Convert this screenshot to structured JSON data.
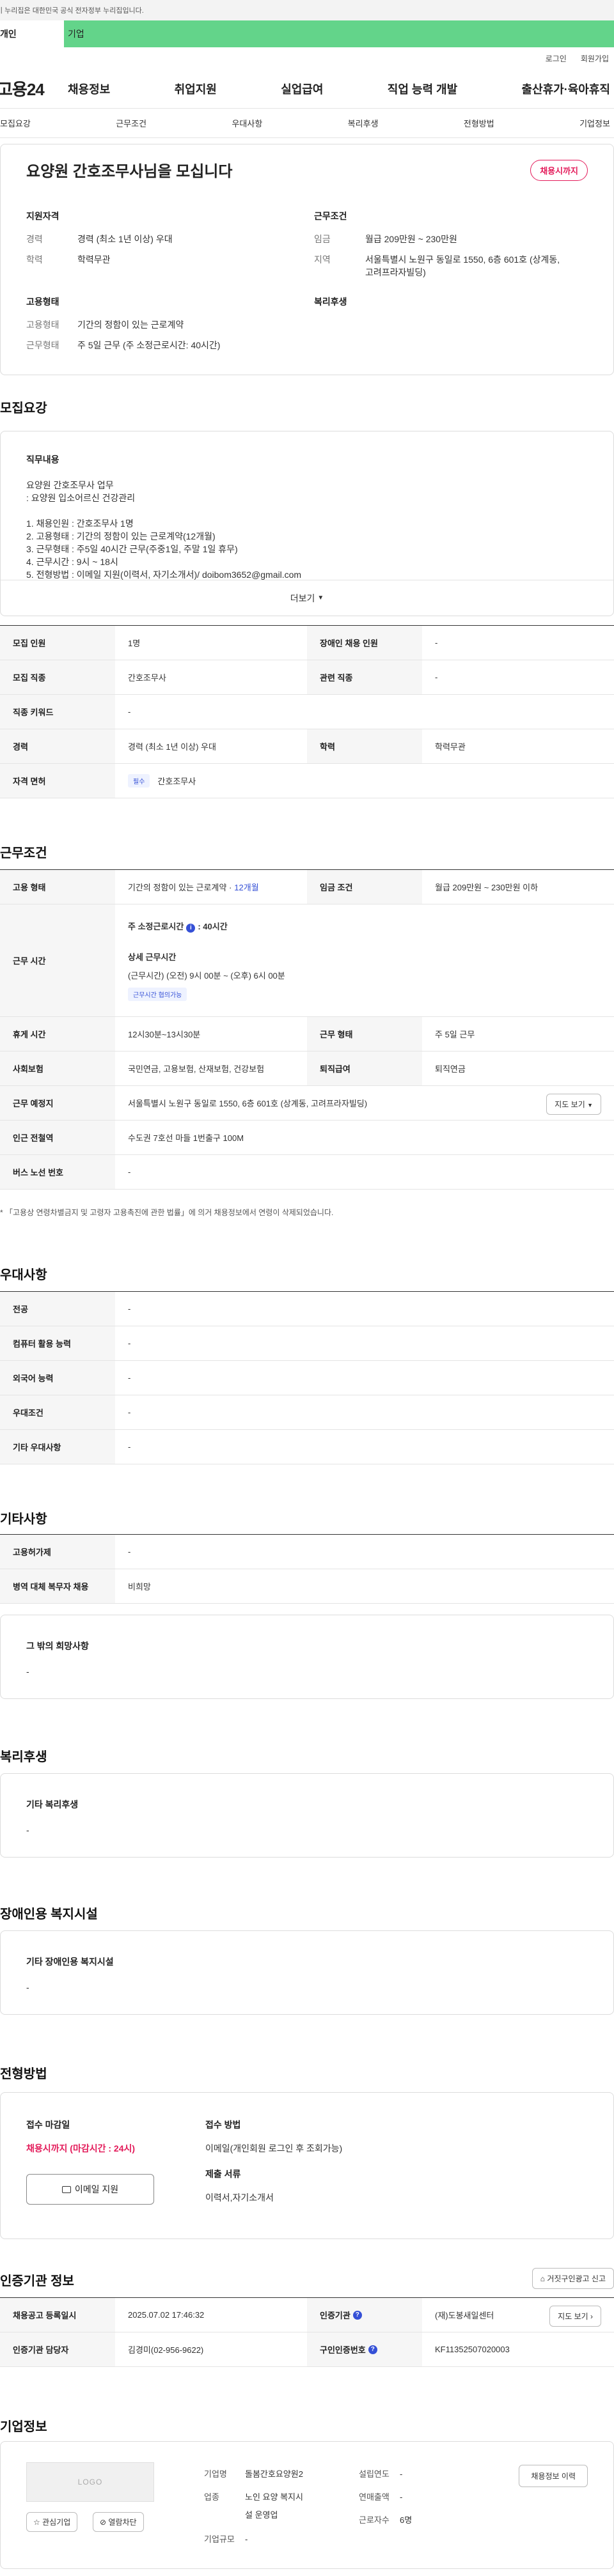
{
  "gov_banner": "이 누리집은 대한민국 공식 전자정부 누리집입니다.",
  "user_tabs": [
    "개인",
    "기업"
  ],
  "util": [
    "로그인",
    "회원가입"
  ],
  "logo": "고용24",
  "gnb": [
    "채용정보",
    "취업지원",
    "실업급여",
    "직업 능력 개발",
    "출산휴가·육아휴직"
  ],
  "anchors": [
    "모집요강",
    "근무조건",
    "우대사항",
    "복리후생",
    "전형방법",
    "기업정보"
  ],
  "summary": {
    "title": "요양원 간호조무사님을 모십니다",
    "status": "채용시까지",
    "qual_head": "지원자격",
    "career_k": "경력",
    "career_v": "경력 (최소 1년 이상) 우대",
    "edu_k": "학력",
    "edu_v": "학력무관",
    "emp_head": "고용형태",
    "emptype_k": "고용형태",
    "emptype_v": "기간의 정함이 있는 근로계약",
    "worktime_k": "근무형태",
    "worktime_v": "주 5일 근무 (주 소정근로시간: 40시간)",
    "cond_head": "근무조건",
    "wage_k": "임금",
    "wage_v": "월급 209만원 ~ 230만원",
    "area_k": "지역",
    "area_v1": "서울특별시 노원구 동일로 1550, 6층 601호 (상계동,",
    "area_v2": "고려프라자빌딩)",
    "welfare_head": "복리후생"
  },
  "recruit": {
    "title": "모집요강",
    "duty_head": "직무내용",
    "duty_body": "요양원 간호조무사 업무\n: 요양원 입소어르신 건강관리\n\n1. 채용인원 : 간호조무사 1명\n2. 고용형태 : 기간의 정함이 있는 근로계약(12개월)\n3. 근무형태 : 주5일 40시간 근무(주중1일, 주말 1일 휴무)\n4. 근무시간 : 9시 ~ 18시\n5. 전형방법 : 이메일 지원(이력서, 자기소개서)/ doibom3652@gmail.com",
    "more": "더보기",
    "rows": [
      {
        "k1": "모집 인원",
        "v1": "1명",
        "k2": "장애인 채용 인원",
        "v2": "-"
      },
      {
        "k1": "모집 직종",
        "v1": "간호조무사",
        "k2": "관련 직종",
        "v2": "-"
      },
      {
        "k1": "직종 키워드",
        "v1": "-"
      },
      {
        "k1": "경력",
        "v1": "경력 (최소 1년 이상) 우대",
        "k2": "학력",
        "v2": "학력무관"
      },
      {
        "k1": "자격 면허",
        "tag": "필수",
        "v1": "간호조무사"
      }
    ]
  },
  "conditions": {
    "title": "근무조건",
    "emp_k": "고용 형태",
    "emp_v": "기간의 정함이 있는 근로계약 · ",
    "emp_period": "12개월",
    "wage_k": "임금 조건",
    "wage_v": "월급 209만원 ~ 230만원 이하",
    "hours_k": "근무 시간",
    "hours_main": "주 소정근로시간",
    "hours_main_v": ": 40시간",
    "hours_detail_head": "상세 근무시간",
    "hours_detail": "(근무시간) (오전) 9시 00분 ~ (오후) 6시 00분",
    "hours_tag": "근무시간 협의가능",
    "break_k": "휴게 시간",
    "break_v": "12시30분~13시30분",
    "type_k": "근무 형태",
    "type_v": "주 5일 근무",
    "ins_k": "사회보험",
    "ins_v": "국민연금, 고용보험, 산재보험, 건강보험",
    "ret_k": "퇴직급여",
    "ret_v": "퇴직연금",
    "place_k": "근무 예정지",
    "place_v": "서울특별시 노원구 동일로 1550, 6층 601호 (상계동, 고려프라자빌딩)",
    "map_btn": "지도 보기",
    "subway_k": "인근 전철역",
    "subway_v": "수도권 7호선 마들 1번출구 100M",
    "bus_k": "버스 노선 번호",
    "bus_v": "-",
    "note": "* 「고용상 연령차별금지 및 고령자 고용촉진에 관한 법률」에 의거 채용정보에서 연령이 삭제되었습니다."
  },
  "preference": {
    "title": "우대사항",
    "rows": [
      {
        "k": "전공",
        "v": "-"
      },
      {
        "k": "컴퓨터 활용 능력",
        "v": "-"
      },
      {
        "k": "외국어 능력",
        "v": "-"
      },
      {
        "k": "우대조건",
        "v": "-"
      },
      {
        "k": "기타 우대사항",
        "v": "-"
      }
    ]
  },
  "etc": {
    "title": "기타사항",
    "rows": [
      {
        "k": "고용허가제",
        "v": "-"
      },
      {
        "k": "병역 대체 복무자 채용",
        "v": "비희망"
      }
    ],
    "hope_head": "그 밖의 희망사항",
    "hope_body": "-"
  },
  "welfare": {
    "title": "복리후생",
    "head": "기타 복리후생",
    "body": "-"
  },
  "disability": {
    "title": "장애인용 복지시설",
    "head": "기타 장애인용 복지시설",
    "body": "-"
  },
  "process": {
    "title": "전형방법",
    "deadline_head": "접수 마감일",
    "deadline_v": "채용시까지 (마감시간 : 24시)",
    "apply_btn": "이메일 지원",
    "method_head": "접수 방법",
    "method_v": "이메일(개인회원 로그인 후 조회가능)",
    "docs_head": "제출 서류",
    "docs_v": "이력서,자기소개서"
  },
  "cert": {
    "title": "인증기관 정보",
    "ad_btn": "거짓구인광고 신고",
    "reg_k": "채용공고 등록일시",
    "reg_v": "2025.07.02 17:46:32",
    "inst_k": "인증기관",
    "inst_v": "(재)도봉새일센터",
    "map_btn": "지도 보기",
    "mgr_k": "인증기관 담당자",
    "mgr_v": "김경미(02-956-9622)",
    "no_k": "구인인증번호",
    "no_v": "KF11352507020003"
  },
  "company": {
    "title": "기업정보",
    "logo_text": "LOGO",
    "fav_btn": "관심기업",
    "block_btn": "열람차단",
    "name_k": "기업명",
    "name_v": "돌봄간호요양원2",
    "ind_k": "업종",
    "ind_v1": "노인 요양 복지시",
    "ind_v2": "설 운영업",
    "size_k": "기업규모",
    "size_v": "-",
    "year_k": "설립연도",
    "year_v": "-",
    "sales_k": "연매출액",
    "sales_v": "-",
    "emp_k": "근로자수",
    "emp_v": "6명",
    "list_btn": "채용정보 이력"
  },
  "colors": {
    "green": "#63d48a",
    "red": "#e31b5a",
    "blue": "#3550d6"
  }
}
